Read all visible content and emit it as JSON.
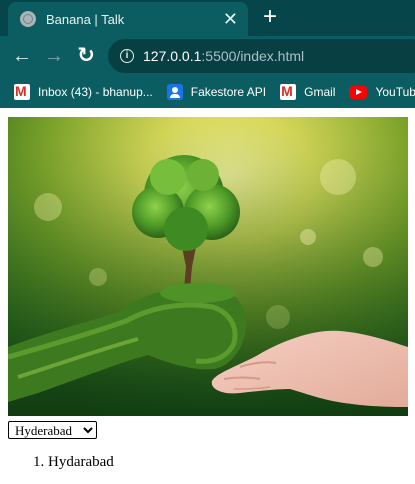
{
  "browser": {
    "tab": {
      "title": "Banana | Talk",
      "close_glyph": "✕",
      "favicon": "globe-icon"
    },
    "new_tab_glyph": "+",
    "nav": {
      "back": "←",
      "forward": "→",
      "reload": "↻"
    },
    "address": {
      "host": "127.0.0.1",
      "rest": ":5500/index.html"
    },
    "bookmarks": [
      {
        "label": "Inbox (43) - bhanup...",
        "icon": "gmail-icon"
      },
      {
        "label": "Fakestore API",
        "icon": "fakestore-icon"
      },
      {
        "label": "Gmail",
        "icon": "gmail-icon"
      },
      {
        "label": "YouTube",
        "icon": "youtube-icon"
      }
    ]
  },
  "page": {
    "hero_image": {
      "description_icon": "tree-in-hands-image"
    },
    "select": {
      "selected": "Hyderabad",
      "options": [
        "Hyderabad"
      ]
    },
    "list": [
      "Hydarabad"
    ]
  },
  "colors": {
    "chrome_dark": "#06464b",
    "chrome": "#0b5d61",
    "omnibox": "#073f43"
  }
}
